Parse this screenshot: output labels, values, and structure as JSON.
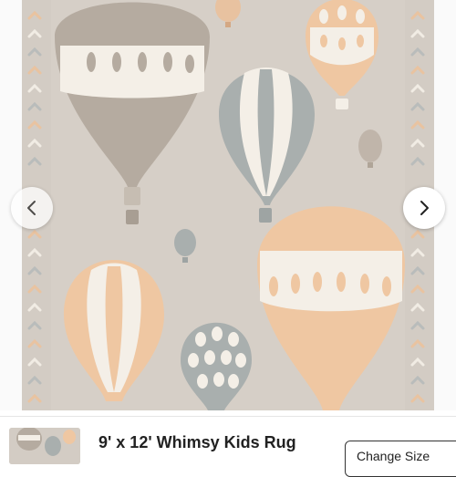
{
  "product": {
    "title": "9' x 12' Whimsy Kids Rug",
    "change_size_label": "Change Size"
  },
  "gallery": {
    "image_alt": "Whimsy kids rug with hot air balloons pattern",
    "prev_icon": "chevron-left-icon",
    "next_icon": "chevron-right-icon"
  },
  "colors": {
    "rug_background": "#d3ccc4",
    "balloon_taupe": "#b5aba0",
    "balloon_peach": "#efc7a2",
    "balloon_grey": "#a9afae",
    "balloon_cream": "#f4efe7"
  }
}
